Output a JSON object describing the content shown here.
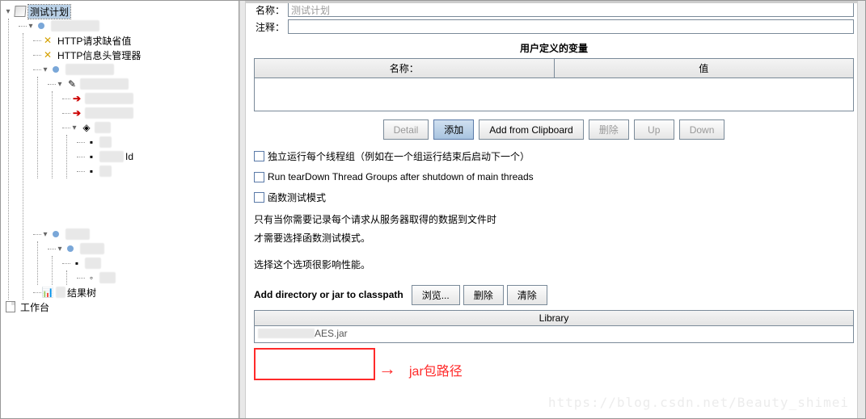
{
  "tree": {
    "root": "测试计划",
    "http_defaults": "HTTP请求缺省值",
    "http_header": "HTTP信息头管理器",
    "id_label": "Id",
    "result_tree": "结果树",
    "workbench": "工作台"
  },
  "form": {
    "name_label": "名称：",
    "name_value": "测试计划",
    "comment_label": "注释：",
    "comment_value": ""
  },
  "vars": {
    "title": "用户定义的变量",
    "col_name": "名称：",
    "col_value": "值"
  },
  "buttons": {
    "detail": "Detail",
    "add": "添加",
    "add_clip": "Add from Clipboard",
    "delete": "删除",
    "up": "Up",
    "down": "Down"
  },
  "checks": {
    "independent": "独立运行每个线程组（例如在一个组运行结束后启动下一个）",
    "teardown": "Run tearDown Thread Groups after shutdown of main threads",
    "func_mode": "函数测试模式"
  },
  "info": {
    "line1": "只有当你需要记录每个请求从服务器取得的数据到文件时",
    "line2": "才需要选择函数测试模式。",
    "line3": "选择这个选项很影响性能。"
  },
  "classpath": {
    "label": "Add directory or jar to classpath",
    "browse": "浏览...",
    "delete": "删除",
    "clear": "清除",
    "header": "Library",
    "entry_suffix": "AES.jar"
  },
  "annot": {
    "text": "jar包路径"
  },
  "watermark": "https://blog.csdn.net/Beauty_shimei"
}
